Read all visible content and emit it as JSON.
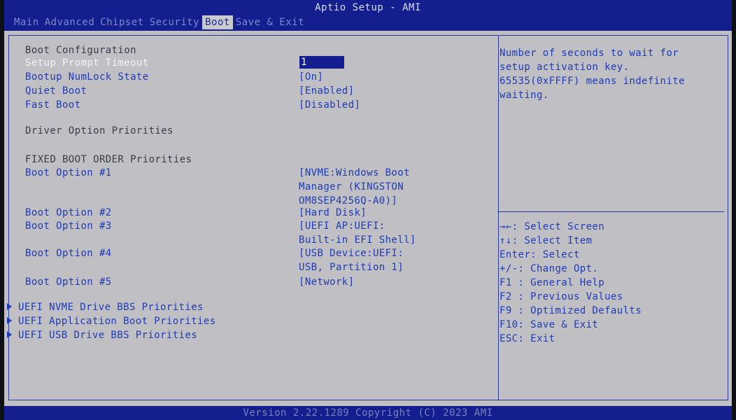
{
  "header": {
    "title": "Aptio Setup - AMI",
    "tabs": [
      "Main",
      "Advanced",
      "Chipset",
      "Security",
      "Boot",
      "Save & Exit"
    ],
    "active_tab": "Boot"
  },
  "boot": {
    "section_boot_config": "Boot Configuration",
    "setup_prompt_timeout": {
      "label": "Setup Prompt Timeout",
      "value": "1"
    },
    "bootup_numlock": {
      "label": "Bootup NumLock State",
      "value": "[On]"
    },
    "quiet_boot": {
      "label": "Quiet Boot",
      "value": "[Enabled]"
    },
    "fast_boot": {
      "label": "Fast Boot",
      "value": "[Disabled]"
    },
    "section_driver_priorities": "Driver Option Priorities",
    "section_fixed_boot_order": "FIXED BOOT ORDER Priorities",
    "boot_options": [
      {
        "label": "Boot Option #1",
        "value_lines": [
          "[NVME:Windows Boot",
          "Manager (KINGSTON",
          "OM8SEP4256Q-A0)]"
        ]
      },
      {
        "label": "Boot Option #2",
        "value_lines": [
          "[Hard Disk]"
        ]
      },
      {
        "label": "Boot Option #3",
        "value_lines": [
          "[UEFI AP:UEFI:",
          "Built-in EFI Shell]"
        ]
      },
      {
        "label": "Boot Option #4",
        "value_lines": [
          "[USB Device:UEFI:",
          "USB, Partition 1]"
        ]
      },
      {
        "label": "Boot Option #5",
        "value_lines": [
          "[Network]"
        ]
      }
    ],
    "submenus": [
      "UEFI NVME Drive BBS Priorities",
      "UEFI Application Boot Priorities",
      "UEFI USB Drive BBS Priorities"
    ]
  },
  "help": {
    "description_lines": [
      "Number of seconds to wait for",
      "setup activation key.",
      "65535(0xFFFF) means indefinite",
      "waiting."
    ],
    "keys": [
      "→←: Select Screen",
      "↑↓: Select Item",
      "Enter: Select",
      "+/-: Change Opt.",
      "F1 : General Help",
      "F2 : Previous Values",
      "F9 : Optimized Defaults",
      "F10: Save & Exit",
      "ESC: Exit"
    ]
  },
  "footer": {
    "text": "Version 2.22.1289 Copyright (C) 2023 AMI"
  }
}
